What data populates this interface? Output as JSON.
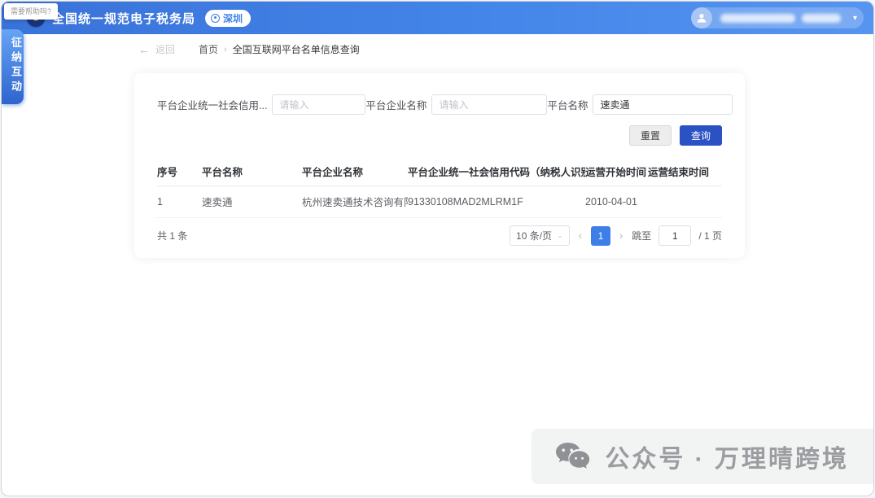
{
  "tooltip": {
    "text": "需要帮助吗?"
  },
  "header": {
    "title": "全国统一规范电子税务局",
    "location_badge": "深圳",
    "user_caret": "▾"
  },
  "sidebar": {
    "tab_label": "征纳互动"
  },
  "breadcrumb": {
    "back_arrow": "←",
    "back_label": "返回",
    "home": "首页",
    "separator": "›",
    "current": "全国互联网平台名单信息查询"
  },
  "form": {
    "fields": [
      {
        "label": "平台企业统一社会信用...",
        "placeholder": "请输入",
        "value": ""
      },
      {
        "label": "平台企业名称",
        "placeholder": "请输入",
        "value": ""
      },
      {
        "label": "平台名称",
        "placeholder": "",
        "value": "速卖通"
      }
    ],
    "reset_label": "重置",
    "query_label": "查询"
  },
  "table": {
    "columns": [
      "序号",
      "平台名称",
      "平台企业名称",
      "平台企业统一社会信用代码（纳税人识别号）",
      "运营开始时间",
      "运营结束时间"
    ],
    "rows": [
      [
        "1",
        "速卖通",
        "杭州速卖通技术咨询有限公司",
        "91330108MAD2MLRM1F",
        "2010-04-01",
        ""
      ]
    ]
  },
  "pagination": {
    "total_text": "共 1 条",
    "page_size": "10 条/页",
    "size_caret": "⌄",
    "prev": "‹",
    "next": "›",
    "current_page": "1",
    "jump_label": "跳至",
    "jump_value": "1",
    "pages_suffix": "/ 1 页"
  },
  "watermark": {
    "label": "公众号 · 万理晴跨境"
  },
  "colors": {
    "header_blue": "#4385e9",
    "accent_blue": "#3d7ee8",
    "query_button": "#2b52c4",
    "watermark_gray": "#9b9da1"
  }
}
